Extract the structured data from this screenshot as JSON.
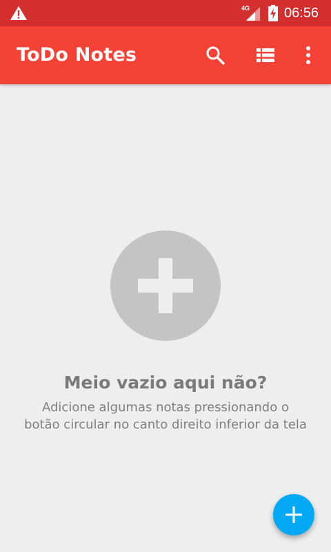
{
  "status_bar": {
    "network": "4G",
    "time": "06:56",
    "icons": [
      "warning-icon",
      "signal-icon",
      "battery-charging-icon"
    ]
  },
  "app_bar": {
    "title": "ToDo Notes",
    "actions": [
      "search-icon",
      "view-list-icon",
      "more-vert-icon"
    ]
  },
  "empty_state": {
    "icon": "add-icon",
    "title": "Meio vazio aqui não?",
    "description_line1": "Adicione algumas notas pressionando o",
    "description_line2": "botão circular no canto direito inferior da tela"
  },
  "fab": {
    "icon": "add-icon"
  },
  "colors": {
    "status_bar": "#d32f2f",
    "app_bar": "#f44336",
    "background": "#eeeeee",
    "empty_circle": "#c4c4c4",
    "fab": "#03a9f4"
  }
}
